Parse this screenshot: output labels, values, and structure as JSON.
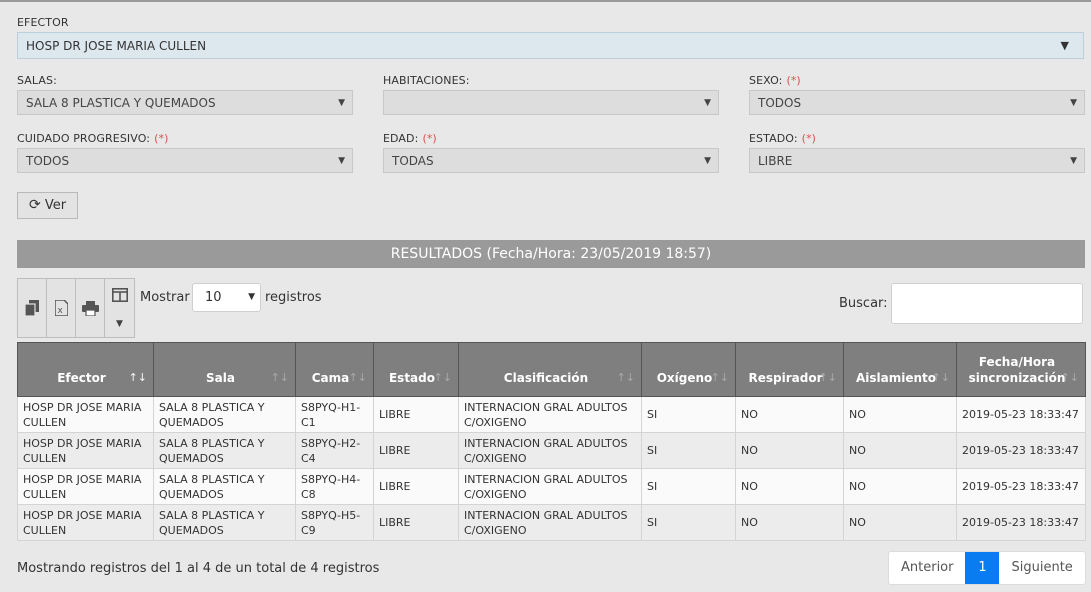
{
  "filters": {
    "efector": {
      "label": "EFECTOR",
      "value": "HOSP DR JOSE MARIA CULLEN"
    },
    "salas": {
      "label": "SALAS:",
      "value": "SALA 8 PLASTICA Y QUEMADOS"
    },
    "habitaciones": {
      "label": "HABITACIONES:",
      "value": ""
    },
    "sexo": {
      "label": "SEXO:",
      "required": "(*)",
      "value": "TODOS"
    },
    "cuidado": {
      "label": "CUIDADO PROGRESIVO:",
      "required": "(*)",
      "value": "TODOS"
    },
    "edad": {
      "label": "EDAD:",
      "required": "(*)",
      "value": "TODAS"
    },
    "estado": {
      "label": "ESTADO:",
      "required": "(*)",
      "value": "LIBRE"
    },
    "ver_label": "Ver"
  },
  "results_title": "RESULTADOS (Fecha/Hora: 23/05/2019 18:57)",
  "table_controls": {
    "mostrar": "Mostrar",
    "length_value": "10",
    "registros": "registros",
    "buscar": "Buscar:",
    "search_value": ""
  },
  "table": {
    "headers": [
      "Efector",
      "Sala",
      "Cama",
      "Estado",
      "Clasificación",
      "Oxígeno",
      "Respirador",
      "Aislamiento",
      "Fecha/Hora sincronización"
    ],
    "rows": [
      [
        "HOSP DR JOSE MARIA CULLEN",
        "SALA 8 PLASTICA Y QUEMADOS",
        "S8PYQ-H1-C1",
        "LIBRE",
        "INTERNACION GRAL ADULTOS C/OXIGENO",
        "SI",
        "NO",
        "NO",
        "2019-05-23 18:33:47"
      ],
      [
        "HOSP DR JOSE MARIA CULLEN",
        "SALA 8 PLASTICA Y QUEMADOS",
        "S8PYQ-H2-C4",
        "LIBRE",
        "INTERNACION GRAL ADULTOS C/OXIGENO",
        "SI",
        "NO",
        "NO",
        "2019-05-23 18:33:47"
      ],
      [
        "HOSP DR JOSE MARIA CULLEN",
        "SALA 8 PLASTICA Y QUEMADOS",
        "S8PYQ-H4-C8",
        "LIBRE",
        "INTERNACION GRAL ADULTOS C/OXIGENO",
        "SI",
        "NO",
        "NO",
        "2019-05-23 18:33:47"
      ],
      [
        "HOSP DR JOSE MARIA CULLEN",
        "SALA 8 PLASTICA Y QUEMADOS",
        "S8PYQ-H5-C9",
        "LIBRE",
        "INTERNACION GRAL ADULTOS C/OXIGENO",
        "SI",
        "NO",
        "NO",
        "2019-05-23 18:33:47"
      ]
    ]
  },
  "footer": {
    "info": "Mostrando registros del 1 al 4 de un total de 4 registros",
    "prev": "Anterior",
    "page": "1",
    "next": "Siguiente"
  },
  "icons": {
    "refresh": "refresh-icon",
    "copy": "copy-icon",
    "excel": "excel-icon",
    "print": "print-icon",
    "columns": "columns-icon"
  }
}
